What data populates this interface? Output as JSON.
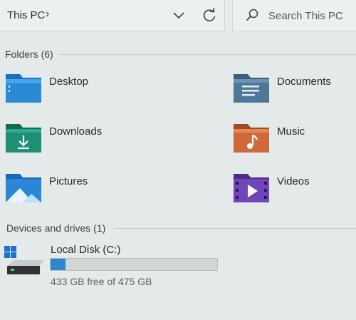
{
  "address_bar": {
    "breadcrumb": "This PC",
    "separator": "›"
  },
  "search": {
    "placeholder": "Search This PC"
  },
  "folders_section": {
    "header": "Folders (6)",
    "items": [
      {
        "label": "Desktop",
        "icon": "desktop-folder-icon"
      },
      {
        "label": "Documents",
        "icon": "documents-folder-icon"
      },
      {
        "label": "Downloads",
        "icon": "downloads-folder-icon"
      },
      {
        "label": "Music",
        "icon": "music-folder-icon"
      },
      {
        "label": "Pictures",
        "icon": "pictures-folder-icon"
      },
      {
        "label": "Videos",
        "icon": "videos-folder-icon"
      }
    ]
  },
  "drives_section": {
    "header": "Devices and drives (1)",
    "drives": [
      {
        "name": "Local Disk (C:)",
        "free_text": "433 GB free of 475 GB",
        "used_fraction": 0.088,
        "bar_color": "#2f86cf"
      }
    ]
  },
  "colors": {
    "background": "#e4e9ea",
    "accent_blue": "#2f86cf"
  }
}
